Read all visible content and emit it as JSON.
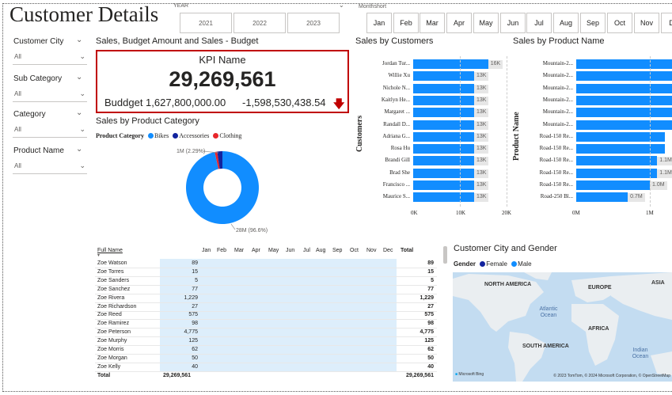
{
  "title": "Customer Details",
  "year_slicer": {
    "label": "YEAR",
    "options": [
      "2021",
      "2022",
      "2023"
    ]
  },
  "month_slicer": {
    "label": "Monthshort",
    "options": [
      "Jan",
      "Feb",
      "Mar",
      "Apr",
      "May",
      "Jun",
      "Jul",
      "Aug",
      "Sep",
      "Oct",
      "Nov",
      "De"
    ]
  },
  "filters": [
    {
      "label": "Customer City",
      "value": "All"
    },
    {
      "label": "Sub Category",
      "value": "All"
    },
    {
      "label": "Category",
      "value": "All"
    },
    {
      "label": "Product Name",
      "value": "All"
    }
  ],
  "kpi": {
    "title": "Sales, Budget Amount and Sales - Budget",
    "name": "KPI Name",
    "value": "29,269,561",
    "budget": "Buddget 1,627,800,000.00",
    "diff": "-1,598,530,438.54",
    "arrow": "🡇",
    "arrow_color": "#c00000"
  },
  "donut": {
    "title": "Sales by Product Category",
    "legend_title": "Product Category",
    "legend": [
      {
        "name": "Bikes",
        "color": "#118dff"
      },
      {
        "name": "Accessories",
        "color": "#12239e"
      },
      {
        "name": "Clothing",
        "color": "#e8262a"
      }
    ],
    "label_small": "1M (2.29%)",
    "label_big": "28M (96.6%)"
  },
  "customers_chart": {
    "title": "Sales by Customers",
    "axis_title": "Customers",
    "ticks": [
      "0K",
      "10K",
      "20K"
    ]
  },
  "products_chart": {
    "title": "Sales by Product Name",
    "axis_title": "Product Name",
    "ticks": [
      "0M",
      "1M"
    ]
  },
  "chart_data": [
    {
      "type": "pie",
      "title": "Sales by Product Category",
      "categories": [
        "Bikes",
        "Accessories",
        "Clothing"
      ],
      "values": [
        28.27,
        0.67,
        0.33
      ],
      "colors": [
        "#118dff",
        "#12239e",
        "#e8262a"
      ]
    },
    {
      "type": "bar",
      "title": "Sales by Customers",
      "categories": [
        "Jordan Tur...",
        "Willie Xu",
        "Nichole N...",
        "Kaitlyn He...",
        "Margaret ...",
        "Randall D...",
        "Adriana G...",
        "Rosa Hu",
        "Brandi Gill",
        "Brad She",
        "Francisco ...",
        "Maurice S..."
      ],
      "values": [
        16000,
        13000,
        13000,
        13000,
        13000,
        13000,
        13000,
        13000,
        13000,
        13000,
        13000,
        13000
      ],
      "labels": [
        "16K",
        "13K",
        "13K",
        "13K",
        "13K",
        "13K",
        "13K",
        "13K",
        "13K",
        "13K",
        "13K",
        "13K"
      ],
      "xlim": [
        0,
        20000
      ]
    },
    {
      "type": "bar",
      "title": "Sales by Product Name",
      "categories": [
        "Mountain-2...",
        "Mountain-2...",
        "Mountain-2...",
        "Mountain-2...",
        "Mountain-2...",
        "Mountain-2...",
        "Road-150 Re...",
        "Road-150 Re...",
        "Road-150 Re...",
        "Road-150 Re...",
        "Road-150 Re...",
        "Road-250 Bl..."
      ],
      "values": [
        1.3,
        1.3,
        1.3,
        1.3,
        1.3,
        1.3,
        1.2,
        1.2,
        1.1,
        1.1,
        1.0,
        0.7
      ],
      "labels": [
        "",
        "",
        "",
        "",
        "",
        "",
        "",
        "",
        "1.1M",
        "1.1M",
        "1.0M",
        "0.7M"
      ],
      "unit": "M"
    }
  ],
  "matrix": {
    "headers": [
      "Full Name",
      "Jan",
      "Feb",
      "Mar",
      "Apr",
      "May",
      "Jun",
      "Jul",
      "Aug",
      "Sep",
      "Oct",
      "Nov",
      "Dec",
      "Total"
    ],
    "rows": [
      {
        "name": "Zoe Watson",
        "jan": "89",
        "total": "89"
      },
      {
        "name": "Zoe Torres",
        "jan": "15",
        "total": "15"
      },
      {
        "name": "Zoe Sanders",
        "jan": "5",
        "total": "5"
      },
      {
        "name": "Zoe Sanchez",
        "jan": "77",
        "total": "77"
      },
      {
        "name": "Zoe Rivera",
        "jan": "1,229",
        "total": "1,229"
      },
      {
        "name": "Zoe Richardson",
        "jan": "27",
        "total": "27"
      },
      {
        "name": "Zoe Reed",
        "jan": "575",
        "total": "575"
      },
      {
        "name": "Zoe Ramirez",
        "jan": "98",
        "total": "98"
      },
      {
        "name": "Zoe Peterson",
        "jan": "4,775",
        "total": "4,775"
      },
      {
        "name": "Zoe Murphy",
        "jan": "125",
        "total": "125"
      },
      {
        "name": "Zoe Morris",
        "jan": "62",
        "total": "62"
      },
      {
        "name": "Zoe Morgan",
        "jan": "50",
        "total": "50"
      },
      {
        "name": "Zoe Kelly",
        "jan": "40",
        "total": "40"
      }
    ],
    "total_label": "Total",
    "total_jan": "29,269,561",
    "total_total": "29,269,561"
  },
  "map": {
    "title": "Customer City and Gender",
    "legend_title": "Gender",
    "legend": [
      {
        "name": "Female",
        "color": "#12239e"
      },
      {
        "name": "Male",
        "color": "#118dff"
      }
    ],
    "labels": {
      "na": "NORTH AMERICA",
      "eu": "EUROPE",
      "asia": "ASIA",
      "af": "AFRICA",
      "sa": "SOUTH AMERICA",
      "atl": "Atlantic Ocean",
      "ind": "Indian Ocean"
    },
    "credit": "Microsoft Bing",
    "copyright": "© 2023 TomTom, © 2024 Microsoft Corporation, © OpenStreetMap"
  }
}
